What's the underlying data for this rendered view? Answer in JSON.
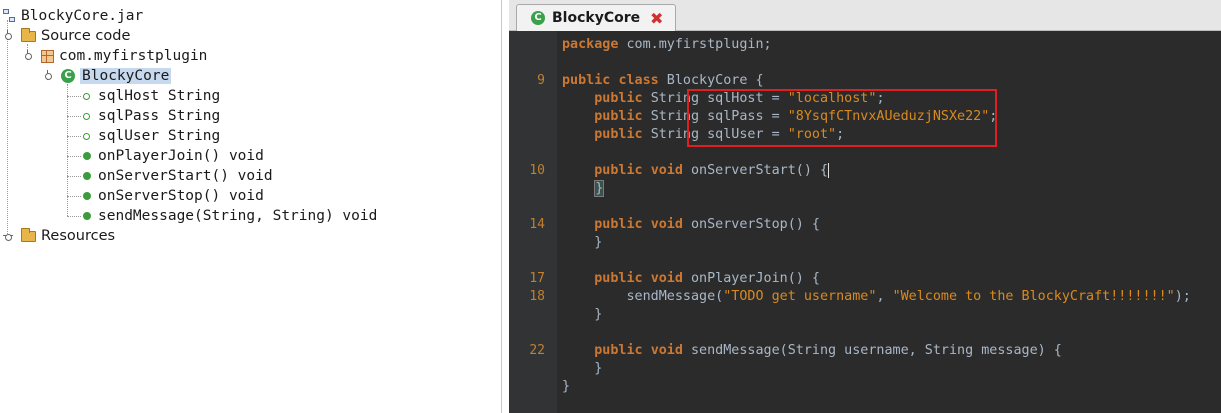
{
  "tree": {
    "jar": "BlockyCore.jar",
    "source": "Source code",
    "package": "com.myfirstplugin",
    "class": "BlockyCore",
    "class_icon_letter": "C",
    "members": [
      {
        "label": "sqlHost String",
        "kind": "field"
      },
      {
        "label": "sqlPass String",
        "kind": "field"
      },
      {
        "label": "sqlUser String",
        "kind": "field"
      },
      {
        "label": "onPlayerJoin() void",
        "kind": "method"
      },
      {
        "label": "onServerStart() void",
        "kind": "method"
      },
      {
        "label": "onServerStop() void",
        "kind": "method"
      },
      {
        "label": "sendMessage(String, String) void",
        "kind": "method"
      }
    ],
    "resources": "Resources"
  },
  "editor": {
    "tab_title": "BlockyCore",
    "tab_close": "✖",
    "kw": {
      "package": "package",
      "public": "public",
      "class": "class",
      "void": "void"
    },
    "type_string": "String",
    "line_numbers": [
      "9",
      "10",
      "14",
      "17",
      "18",
      "22"
    ],
    "code": {
      "package_name": " com.myfirstplugin;",
      "class_decl": " BlockyCore {",
      "sqlhost_name": " sqlHost = ",
      "sqlhost_value": "\"localhost\"",
      "sqlpass_name": " sqlPass = ",
      "sqlpass_value": "\"8YsqfCTnvxAUeduzjNSXe22\"",
      "sqluser_name": " sqlUser = ",
      "sqluser_value": "\"root\"",
      "semicolon": ";",
      "onserverstart": " onServerStart() {",
      "onserverstop": " onServerStop() {",
      "onplayerjoin": " onPlayerJoin() {",
      "sendmessage_call": "sendMessage(",
      "todo_str": "\"TODO get username\"",
      "comma": ", ",
      "welcome_str": "\"Welcome to the BlockyCraft!!!!!!!\"",
      "call_end": ");",
      "sendmessage_decl": " sendMessage(String username, String message) {",
      "close_brace": "}",
      "indent_close_brace": "    }"
    }
  },
  "colors": {
    "keyword": "#cc7832",
    "string": "#d98a1e",
    "text": "#a9b7c6",
    "background": "#2b2b2b",
    "highlight_box": "#e02020",
    "line_number": "#c08030"
  }
}
